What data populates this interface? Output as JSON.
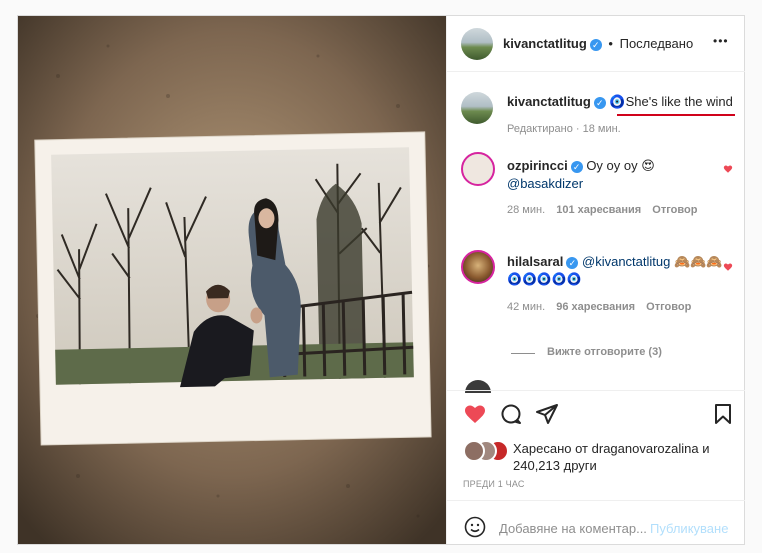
{
  "header": {
    "username": "kivanctatlitug",
    "dot": "•",
    "follow_state": "Последвано",
    "more": "•••"
  },
  "caption": {
    "username": "kivanctatlitug",
    "emoji": "🧿",
    "text": "She's like the wind",
    "edited": "Редактирано · 18 мин."
  },
  "comments": [
    {
      "username": "ozpirincci",
      "text": "Oy oy oy 😍",
      "mention": "@basakdizer",
      "time": "28 мин.",
      "likes": "101 харесвания",
      "reply": "Отговор"
    },
    {
      "username": "hilalsaral",
      "mention": "@kivanctatlitug",
      "text": "🙈🙈🙈",
      "emoji_line": "🧿🧿🧿🧿🧿",
      "time": "42 мин.",
      "likes": "96 харесвания",
      "reply": "Отговор"
    }
  ],
  "view_replies": "Вижте отговорите (3)",
  "likes": {
    "prefix": "Харесано от",
    "user": "draganovarozalina",
    "mid": "и",
    "count": "240,213 други"
  },
  "timestamp": "ПРЕДИ 1 ЧАС",
  "comment_box": {
    "placeholder": "Добавяне на коментар...",
    "publish": "Публикуване"
  },
  "colors": {
    "like_red": "#ed4956",
    "verified_blue": "#3897f0",
    "publish_blue": "#b2dffc",
    "annotation_underline": "#d0021b"
  }
}
